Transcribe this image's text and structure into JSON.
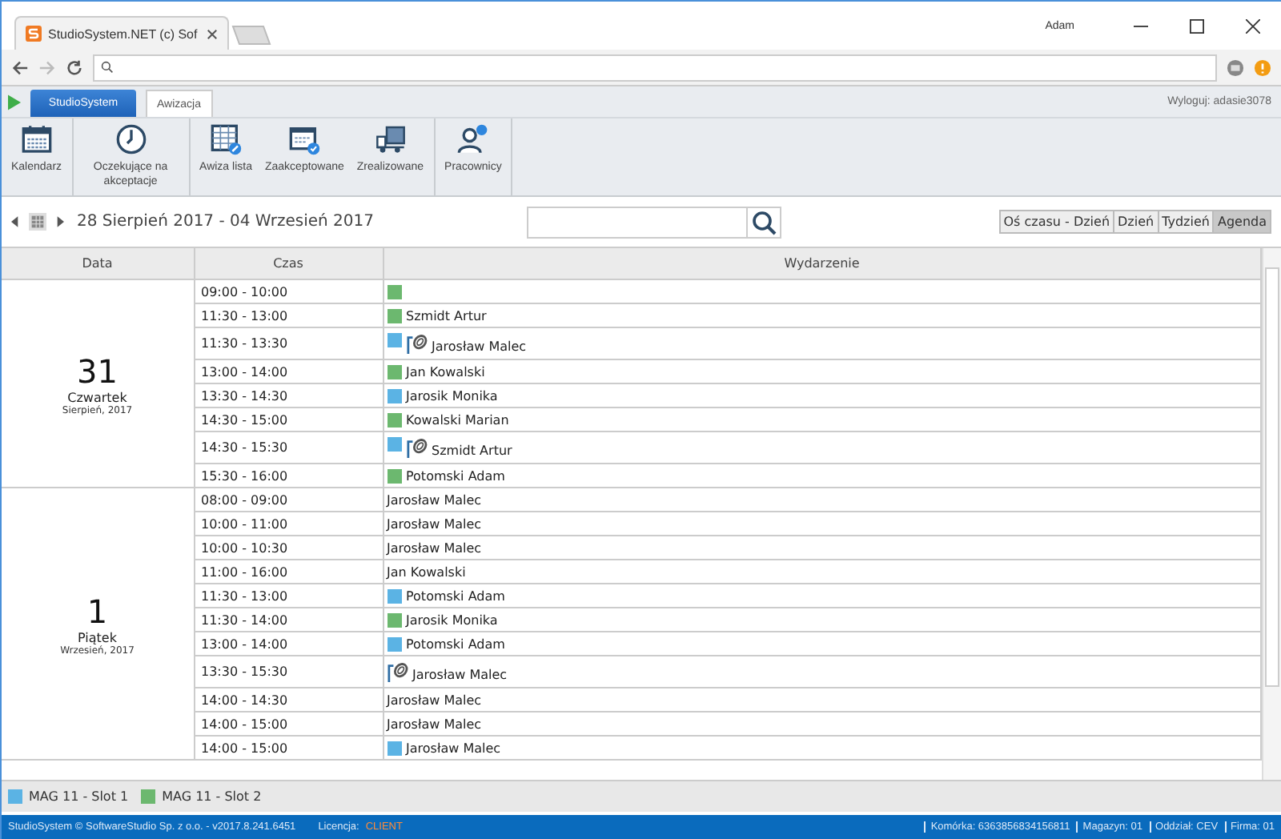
{
  "browser": {
    "tab_title": "StudioSystem.NET (c) Sof",
    "user": "Adam"
  },
  "app": {
    "app_button": "StudioSystem",
    "tabs": [
      {
        "label": "Awizacja",
        "selected": true
      }
    ],
    "logout": "Wyloguj: adasie3078"
  },
  "toolbar": [
    [
      {
        "kind": "calendar",
        "label": "Kalendarz"
      }
    ],
    [
      {
        "kind": "clock",
        "label": "Oczekujące na akceptacje"
      }
    ],
    [
      {
        "kind": "list",
        "label": "Awiza lista"
      },
      {
        "kind": "accepted",
        "label": "Zaakceptowane"
      },
      {
        "kind": "truck",
        "label": "Zrealizowane"
      }
    ],
    [
      {
        "kind": "person",
        "label": "Pracownicy"
      }
    ]
  ],
  "range": "28 Sierpień 2017 - 04 Wrzesień 2017",
  "views": [
    {
      "label": "Oś czasu - Dzień",
      "selected": false
    },
    {
      "label": "Dzień",
      "selected": false
    },
    {
      "label": "Tydzień",
      "selected": false
    },
    {
      "label": "Agenda",
      "selected": true
    }
  ],
  "table": {
    "columns": [
      "Data",
      "Czas",
      "Wydarzenie"
    ],
    "days": [
      {
        "day": "31",
        "weekday": "Czwartek",
        "month": "Sierpień, 2017",
        "events": [
          {
            "time": "09:00 - 10:00",
            "color": "#6cb86f",
            "attachment": false
          },
          {
            "time": "11:30 - 13:00",
            "color": "#6cb86f",
            "attachment": false,
            "name": "Szmidt Artur"
          },
          {
            "time": "11:30 - 13:30",
            "color": "#5bb3e4",
            "attachment": true,
            "name": "Jarosław Malec"
          },
          {
            "time": "13:00 - 14:00",
            "color": "#6cb86f",
            "attachment": false,
            "name": "Jan Kowalski"
          },
          {
            "time": "13:30 - 14:30",
            "color": "#5bb3e4",
            "attachment": false,
            "name": "Jarosik Monika"
          },
          {
            "time": "14:30 - 15:00",
            "color": "#6cb86f",
            "attachment": false,
            "name": "Kowalski Marian"
          },
          {
            "time": "14:30 - 15:30",
            "color": "#5bb3e4",
            "attachment": true,
            "name": "Szmidt Artur"
          },
          {
            "time": "15:30 - 16:00",
            "color": "#6cb86f",
            "attachment": false,
            "name": "Potomski Adam"
          }
        ]
      },
      {
        "day": "1",
        "weekday": "Piątek",
        "month": "Wrzesień, 2017",
        "events": [
          {
            "time": "08:00 - 09:00",
            "attachment": false,
            "name": "Jarosław Malec"
          },
          {
            "time": "10:00 - 11:00",
            "attachment": false,
            "name": "Jarosław Malec"
          },
          {
            "time": "10:00 - 10:30",
            "attachment": false,
            "name": "Jarosław Malec"
          },
          {
            "time": "11:00 - 16:00",
            "attachment": false,
            "name": "Jan Kowalski"
          },
          {
            "time": "11:30 - 13:00",
            "color": "#5bb3e4",
            "attachment": false,
            "name": "Potomski Adam"
          },
          {
            "time": "11:30 - 14:00",
            "color": "#6cb86f",
            "attachment": false,
            "name": "Jarosik Monika"
          },
          {
            "time": "13:00 - 14:00",
            "color": "#5bb3e4",
            "attachment": false,
            "name": "Potomski Adam"
          },
          {
            "time": "13:30 - 15:30",
            "attachment": true,
            "name": "Jarosław Malec"
          },
          {
            "time": "14:00 - 14:30",
            "attachment": false,
            "name": "Jarosław Malec"
          },
          {
            "time": "14:00 - 15:00",
            "attachment": false,
            "name": "Jarosław Malec"
          },
          {
            "time": "14:00 - 15:00",
            "color": "#5bb3e4",
            "attachment": false,
            "name": "Jarosław Malec"
          }
        ]
      }
    ]
  },
  "legend": [
    {
      "label": "MAG 11 - Slot 1",
      "color": "#5bb3e4"
    },
    {
      "label": "MAG 11 - Slot 2",
      "color": "#6cb86f"
    }
  ],
  "status_bar": {
    "copyright": "StudioSystem © SoftwareStudio Sp. z o.o. - v2017.8.241.6451",
    "license_label": "Licencja:",
    "license": "CLIENT",
    "items": [
      "Komórka: 6363856834156811",
      "Magazyn: 01",
      "Oddział: CEV",
      "Firma: 01"
    ]
  }
}
